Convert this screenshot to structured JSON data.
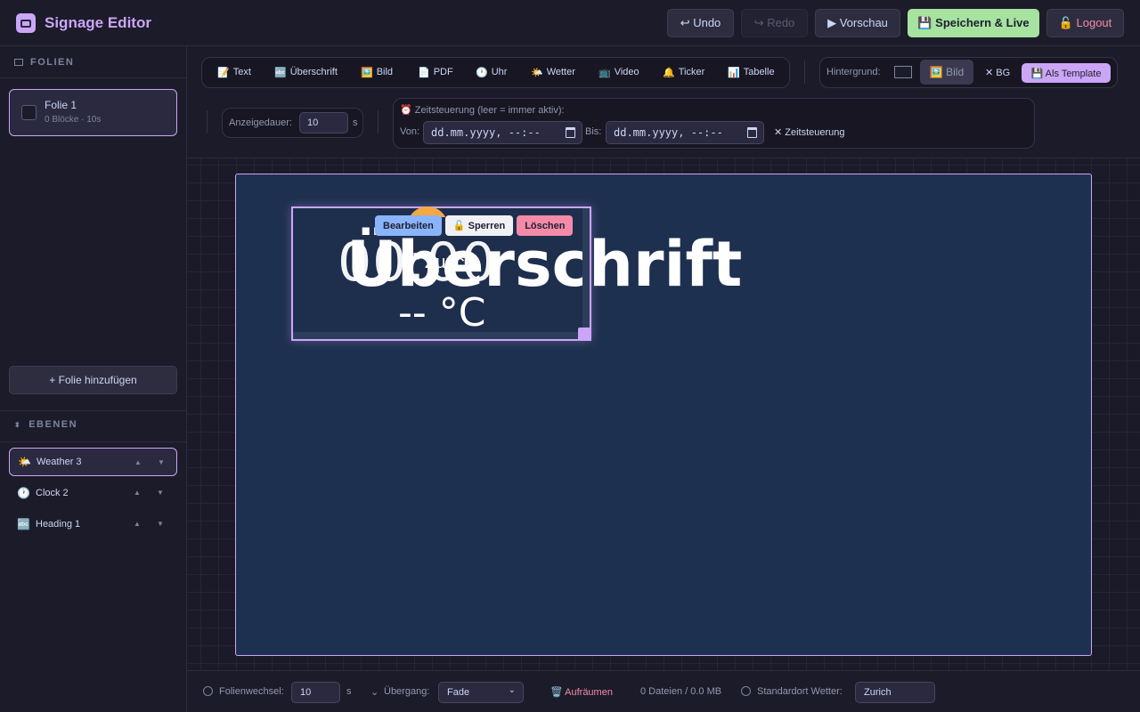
{
  "app": {
    "title": "Signage Editor"
  },
  "header": {
    "undo": "↩ Undo",
    "redo": "↪ Redo",
    "preview": "▶ Vorschau",
    "save_live": "💾 Speichern & Live",
    "logout": "🔓 Logout"
  },
  "sidebar": {
    "slides_title": "FOLIEN",
    "slides": [
      {
        "name": "Folie 1",
        "meta": "0 Blöcke · 10s"
      }
    ],
    "add_slide": "+ Folie hinzufügen",
    "layers_title": "EBENEN",
    "layers": [
      {
        "icon": "🌤️",
        "name": "Weather 3"
      },
      {
        "icon": "🕐",
        "name": "Clock 2"
      },
      {
        "icon": "🔤",
        "name": "Heading 1"
      }
    ],
    "up_arrow": "▲",
    "down_arrow": "▼"
  },
  "toolbar": {
    "tools": [
      {
        "icon": "📝",
        "label": "Text"
      },
      {
        "icon": "🔤",
        "label": "Überschrift"
      },
      {
        "icon": "🖼️",
        "label": "Bild"
      },
      {
        "icon": "📄",
        "label": "PDF"
      },
      {
        "icon": "🕐",
        "label": "Uhr"
      },
      {
        "icon": "🌤️",
        "label": "Wetter"
      },
      {
        "icon": "📺",
        "label": "Video"
      },
      {
        "icon": "🔔",
        "label": "Ticker"
      },
      {
        "icon": "📊",
        "label": "Tabelle"
      }
    ],
    "background_label": "Hintergrund:",
    "background_image": "🖼️ Bild",
    "remove_bg": "✕ BG",
    "as_template": "💾 Als Template",
    "duration_label": "Anzeigedauer:",
    "duration_value": "10",
    "duration_unit": "s",
    "schedule_title": "⏰ Zeitsteuerung (leer = immer aktiv):",
    "from_label": "Von:",
    "from_placeholder": "dd.mm.yyyy, --:--",
    "to_label": "Bis:",
    "to_placeholder": "dd.mm.yyyy, --:--",
    "clear_schedule": "✕ Zeitsteuerung"
  },
  "canvas": {
    "clock": "00:00",
    "heading": "Überschrift",
    "city": "Zurich",
    "temperature": "-- °C",
    "block_actions": {
      "edit": "Bearbeiten",
      "lock": "🔓 Sperren",
      "delete": "Löschen"
    }
  },
  "footer": {
    "slide_change_label": "Folienwechsel:",
    "slide_change_value": "10",
    "slide_change_unit": "s",
    "transition_label": "Übergang:",
    "transition_value": "Fade",
    "cleanup": "🗑️ Aufräumen",
    "files_info": "0 Dateien / 0.0 MB",
    "default_location_label": "Standardort Wetter:",
    "default_location_value": "Zurich"
  },
  "colors": {
    "accent": "#cba6f7",
    "save_green": "#a6e3a1",
    "danger": "#f38ba8",
    "slide_bg": "#1e3050"
  }
}
